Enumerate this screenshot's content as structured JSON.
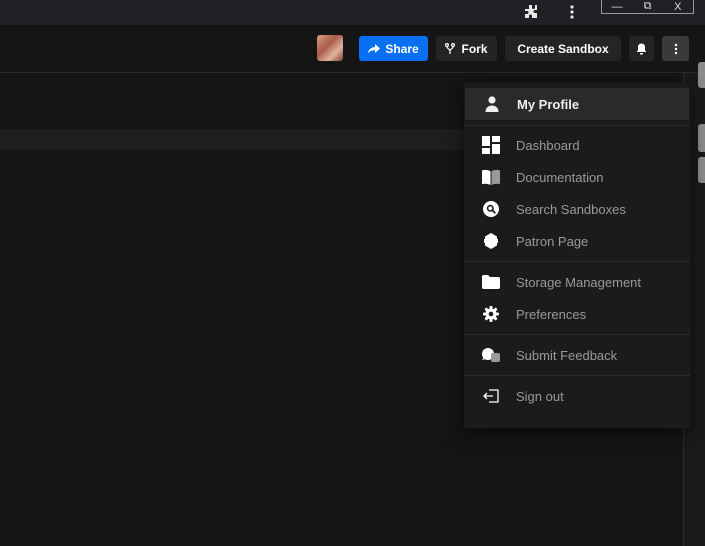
{
  "browser": {
    "window_controls": {
      "minimize": "—",
      "restore": "⧉",
      "close": "X"
    }
  },
  "header": {
    "share_label": "Share",
    "fork_label": "Fork",
    "create_sandbox_label": "Create Sandbox"
  },
  "colors": {
    "accent": "#0971f1",
    "background": "#151515",
    "menu_bg": "#1b1b1b",
    "menu_text": "#9a9a9a",
    "menu_text_active": "#f0f0f0"
  },
  "menu": {
    "items": [
      {
        "label": "My Profile",
        "icon": "user-icon",
        "active": true
      },
      {
        "label": "Dashboard",
        "icon": "dashboard-icon"
      },
      {
        "label": "Documentation",
        "icon": "book-icon"
      },
      {
        "label": "Search Sandboxes",
        "icon": "search-icon"
      },
      {
        "label": "Patron Page",
        "icon": "patron-icon"
      },
      {
        "label": "Storage Management",
        "icon": "folder-icon"
      },
      {
        "label": "Preferences",
        "icon": "gear-icon"
      },
      {
        "label": "Submit Feedback",
        "icon": "chat-icon"
      },
      {
        "label": "Sign out",
        "icon": "sign-out-icon"
      }
    ]
  }
}
